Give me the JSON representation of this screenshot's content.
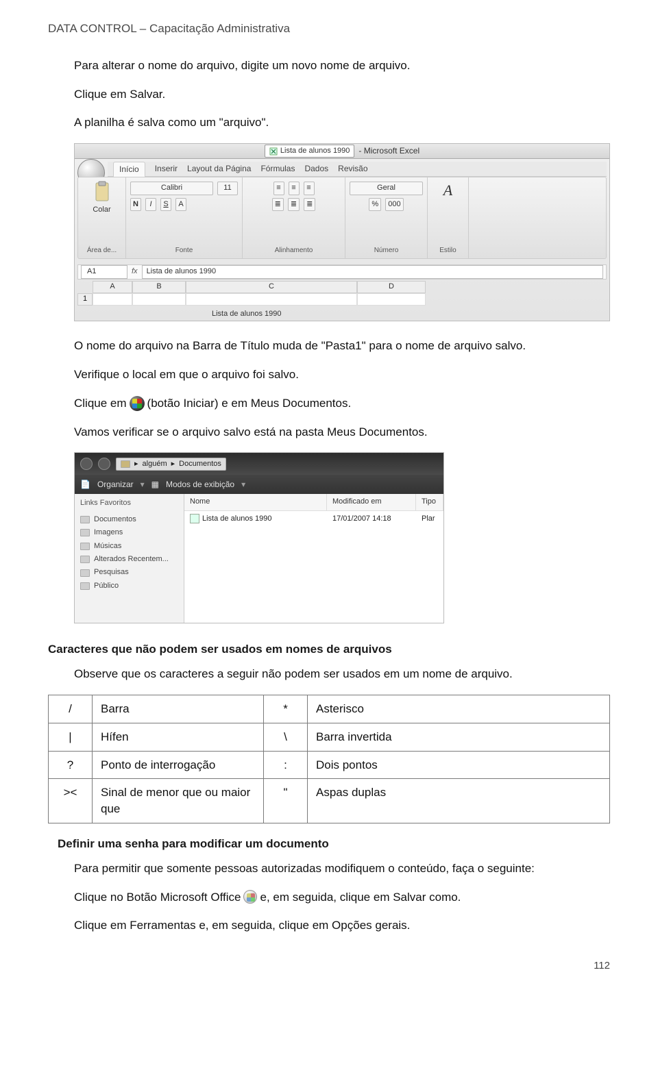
{
  "header": "DATA CONTROL – Capacitação Administrativa",
  "para1": "Para alterar o nome do arquivo, digite um novo nome de arquivo.",
  "para2": "Clique em Salvar.",
  "para3": "A planilha é salva como um \"arquivo\".",
  "excel": {
    "title_suffix": "- Microsoft Excel",
    "doc_name": "Lista de alunos 1990",
    "tabs": [
      "Início",
      "Inserir",
      "Layout da Página",
      "Fórmulas",
      "Dados",
      "Revisão"
    ],
    "clipboard": {
      "label": "Colar",
      "group": "Área de..."
    },
    "font": {
      "name": "Calibri",
      "size": "11",
      "group": "Fonte",
      "buttons": [
        "N",
        "I",
        "S",
        "A"
      ]
    },
    "align": {
      "group": "Alinhamento"
    },
    "number": {
      "format": "Geral",
      "group": "Número",
      "buttons": [
        "%",
        "000"
      ]
    },
    "style": {
      "label": "Estilo",
      "icon": "A"
    },
    "formula": {
      "cell": "A1",
      "fx": "fx",
      "content": "Lista de alunos 1990"
    },
    "cols": [
      "A",
      "B",
      "C",
      "D"
    ],
    "row1_num": "1",
    "row2_text": "Lista de alunos 1990"
  },
  "para4": "O nome do arquivo na Barra de Título muda de \"Pasta1\" para o nome de arquivo salvo.",
  "para5": "Verifique o local em que o arquivo foi salvo.",
  "para6_a": "Clique em",
  "para6_b": "(botão Iniciar) e em Meus Documentos.",
  "para7": "Vamos verificar se o arquivo salvo está na pasta Meus Documentos.",
  "explorer": {
    "path": [
      "alguém",
      "Documentos"
    ],
    "toolbar": {
      "organize": "Organizar",
      "views": "Modos de exibição"
    },
    "favheader": "Links Favoritos",
    "favorites": [
      "Documentos",
      "Imagens",
      "Músicas",
      "Alterados Recentem...",
      "Pesquisas",
      "Público"
    ],
    "cols": [
      "Nome",
      "Modificado em",
      "Tipo"
    ],
    "row": {
      "name": "Lista de alunos 1990",
      "date": "17/01/2007 14:18",
      "type": "Plar"
    }
  },
  "section_chars": "Caracteres que não podem ser usados em nomes de arquivos",
  "para8": "Observe que os caracteres a seguir não podem ser usados em um nome de arquivo.",
  "chars_table": [
    {
      "s1": "/",
      "n1": "Barra",
      "s2": "*",
      "n2": "Asterisco"
    },
    {
      "s1": "|",
      "n1": "Hífen",
      "s2": "\\",
      "n2": "Barra invertida"
    },
    {
      "s1": "?",
      "n1": "Ponto de interrogação",
      "s2": ":",
      "n2": "Dois pontos"
    },
    {
      "s1": "><",
      "n1": "Sinal de menor que ou maior que",
      "s2": "\"",
      "n2": "Aspas duplas"
    }
  ],
  "section_pwd": "Definir uma senha para modificar um documento",
  "para9": "Para permitir que somente pessoas autorizadas modifiquem o conteúdo, faça o seguinte:",
  "para10_a": "Clique no Botão Microsoft Office",
  "para10_b": "e, em seguida, clique em Salvar como.",
  "para11": "Clique em Ferramentas e, em seguida, clique em Opções gerais.",
  "page_number": "112"
}
